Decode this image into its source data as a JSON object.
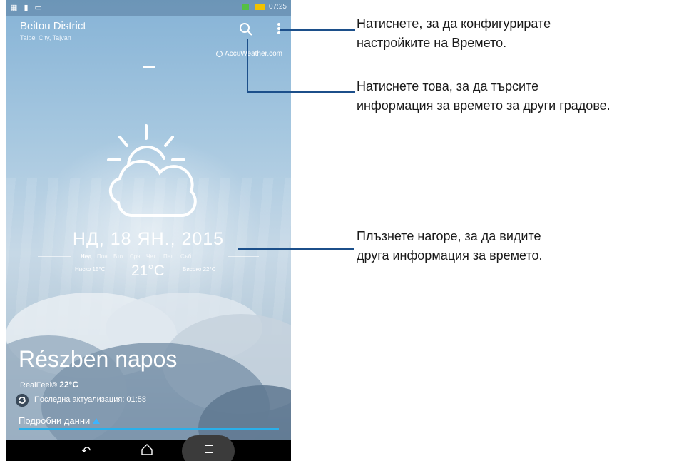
{
  "status_bar": {
    "time": "07:25"
  },
  "location": {
    "name": "Beitou District",
    "sub": "Taipei City, Tajvan"
  },
  "provider": "AccuWeather.com",
  "date": "НД, 18 ЯН., 2015",
  "days": [
    "Нед",
    "Пон",
    "Вто",
    "Сря",
    "Чет",
    "Пет",
    "Съб"
  ],
  "selected_day": "Нед",
  "temps": {
    "low": "Ниско 15°C",
    "current": "21°C",
    "high": "Високо 22°C"
  },
  "condition": "Részben napos",
  "realfeel": {
    "label": "RealFeel®",
    "value": "22°C"
  },
  "updated": "Последна актуализация: 01:58",
  "details_label": "Подробни данни",
  "icons": [
    "search-icon",
    "more-icon",
    "weather-partly-cloudy-icon",
    "refresh-icon",
    "back-icon",
    "home-icon",
    "recent-apps-icon",
    "accuweather-logo-icon"
  ],
  "callouts": {
    "settings": [
      "Натиснете, за да конфигурирате",
      "настройките на Времето."
    ],
    "search": [
      "Натиснете това, за да търсите",
      "информация за времето за други градове."
    ],
    "swipe": [
      "Плъзнете нагоре, за да видите",
      "друга информация за времето."
    ]
  },
  "colors": {
    "accent": "#2ab0ea",
    "callout_line": "#1c4f8a"
  }
}
